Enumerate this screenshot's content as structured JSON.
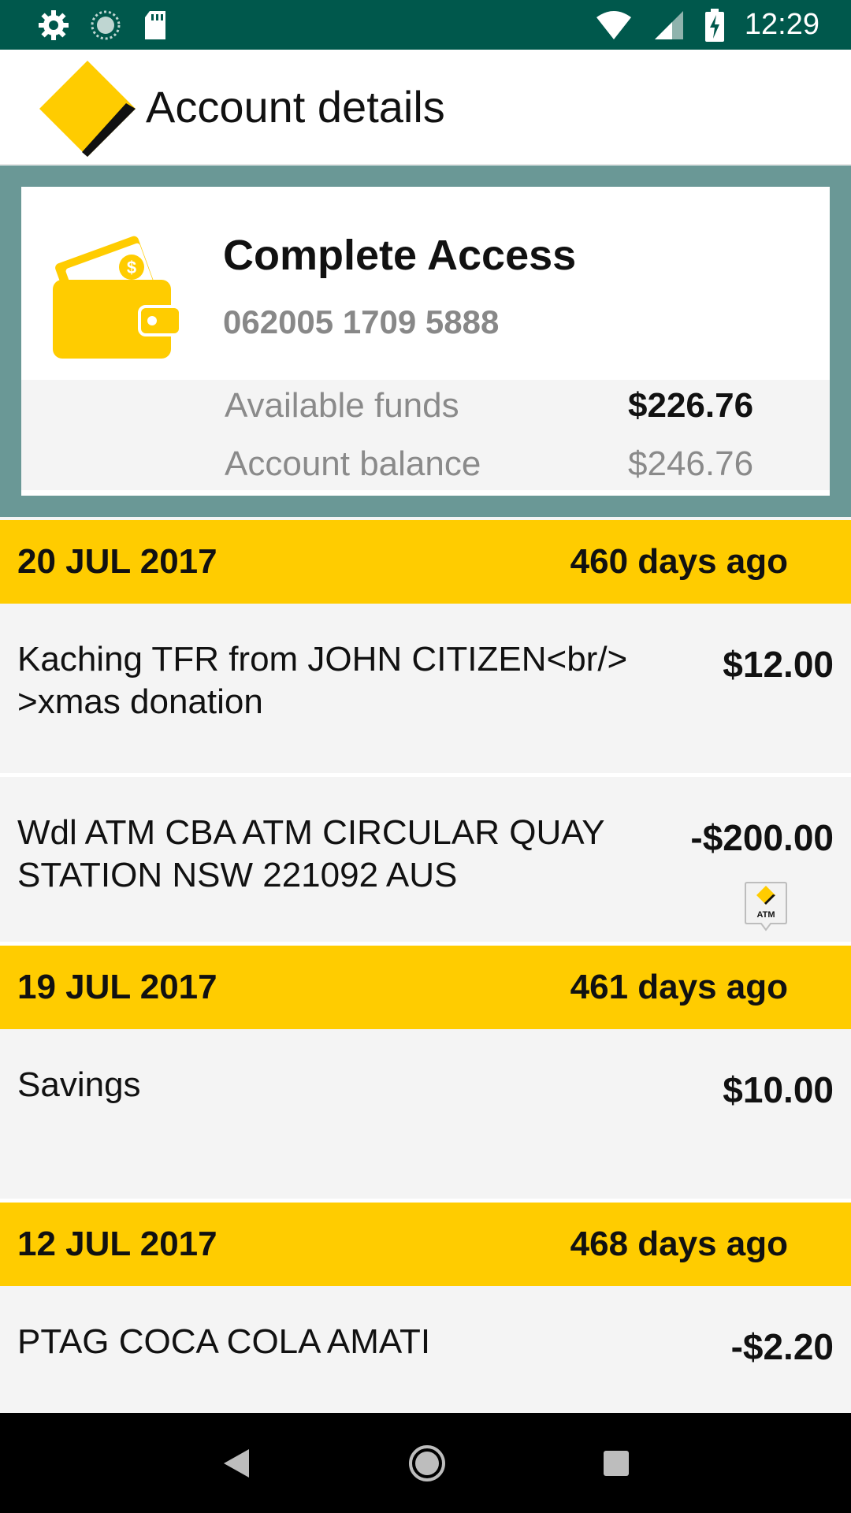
{
  "status_bar": {
    "time": "12:29",
    "icons": [
      "settings-icon",
      "sync-icon",
      "sd-card-icon",
      "wifi-icon",
      "signal-icon",
      "battery-charging-icon"
    ]
  },
  "app_bar": {
    "title": "Account details",
    "logo_icon": "commbank-diamond-logo",
    "colors": {
      "logo_yellow": "#ffcc00",
      "logo_black": "#111111"
    }
  },
  "account": {
    "name": "Complete Access",
    "number": "062005 1709 5888",
    "icon": "wallet-icon",
    "available_label": "Available funds",
    "available_value": "$226.76",
    "balance_label": "Account balance",
    "balance_value": "$246.76",
    "card_border_color": "#6a9896"
  },
  "transactions": {
    "accent_color": "#ffcc00",
    "groups": [
      {
        "date": "20 JUL 2017",
        "ago": "460 days ago",
        "items": [
          {
            "description": "Kaching TFR from JOHN CITIZEN<br/>\n>xmas donation",
            "amount": "$12.00"
          },
          {
            "description": "Wdl ATM CBA ATM CIRCULAR QUAY STATION NSW 221092 AUS",
            "amount": "-$200.00",
            "badge": "ATM"
          }
        ]
      },
      {
        "date": "19 JUL 2017",
        "ago": "461 days ago",
        "items": [
          {
            "description": "Savings",
            "amount": "$10.00"
          }
        ]
      },
      {
        "date": "12 JUL 2017",
        "ago": "468 days ago",
        "items": [
          {
            "description": "PTAG COCA COLA AMATI",
            "amount": "-$2.20"
          }
        ]
      }
    ]
  },
  "nav_bar": {
    "buttons": [
      "back-icon",
      "home-icon",
      "recents-icon"
    ]
  }
}
